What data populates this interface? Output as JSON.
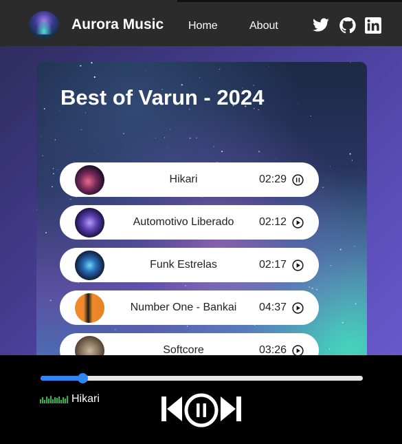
{
  "navbar": {
    "brand": "Aurora Music",
    "links": [
      "Home",
      "About"
    ],
    "social_icons": [
      "twitter-icon",
      "github-icon",
      "linkedin-icon"
    ]
  },
  "playlist": {
    "title": "Best of Varun - 2024",
    "tracks": [
      {
        "title": "Hikari",
        "duration": "02:29",
        "state": "pause-icon"
      },
      {
        "title": "Automotivo Liberado",
        "duration": "02:12",
        "state": "play-icon"
      },
      {
        "title": "Funk Estrelas",
        "duration": "02:17",
        "state": "play-icon"
      },
      {
        "title": "Number One - Bankai",
        "duration": "04:37",
        "state": "play-icon"
      },
      {
        "title": "Softcore",
        "duration": "03:26",
        "state": "play-icon"
      }
    ]
  },
  "player": {
    "now_playing": "Hikari",
    "progress": 0.13,
    "controls": [
      "previous-icon",
      "pause-icon",
      "next-icon"
    ]
  },
  "colors": {
    "accent": "#2e86f5",
    "navbar_bg": "#2b2b2b",
    "player_bg": "#000000",
    "eq_green": "#2fb84a"
  }
}
